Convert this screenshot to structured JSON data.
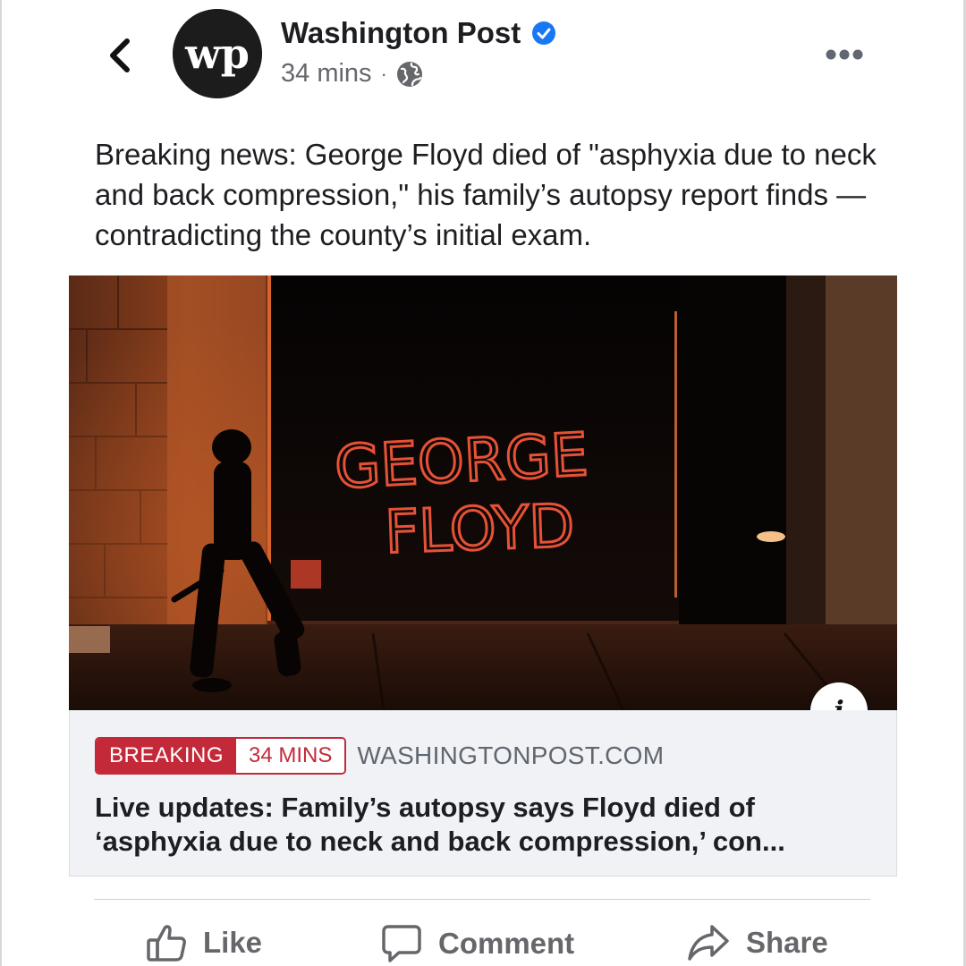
{
  "post": {
    "page_name": "Washington Post",
    "logo_text": "wp",
    "timestamp": "34 mins",
    "separator": "·",
    "caption": "Breaking news: George Floyd died of \"asphyxia due to neck and back compression,\" his family’s autopsy report finds — contradicting the county’s initial exam.",
    "photo": {
      "graffiti_line1": "GEORGE",
      "graffiti_line2": "FLOYD"
    }
  },
  "link": {
    "badge_label": "BREAKING",
    "badge_time": "34 MINS",
    "domain": "WASHINGTONPOST.COM",
    "headline": "Live updates: Family’s autopsy says Floyd died of ‘asphyxia due to neck and back compression,’ con..."
  },
  "actions": {
    "like": "Like",
    "comment": "Comment",
    "share": "Share"
  },
  "icons": {
    "back": "chevron-left-icon",
    "verified": "verified-badge-icon",
    "audience": "globe-icon",
    "more": "more-dots-icon",
    "info": "info-icon"
  },
  "colors": {
    "verified_blue": "#1877f2",
    "breaking_red": "#c4293a",
    "action_gray": "#65676b"
  }
}
